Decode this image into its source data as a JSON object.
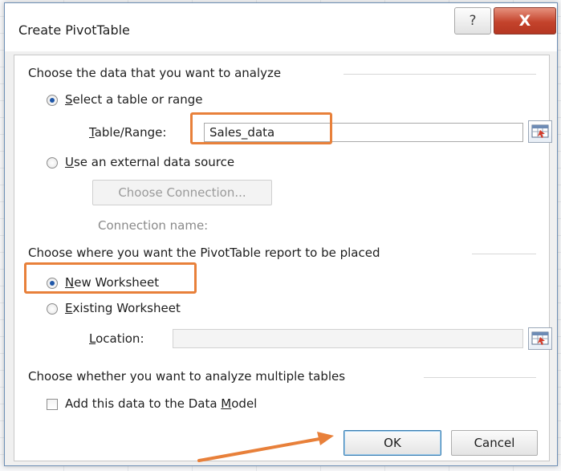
{
  "dialog": {
    "title": "Create PivotTable",
    "help_glyph": "?",
    "close_glyph": "X"
  },
  "section_data": {
    "heading": "Choose the data that you want to analyze",
    "option_table_range": {
      "accel": "S",
      "rest": "elect a table or range",
      "checked": true
    },
    "table_range_label": {
      "accel": "T",
      "rest": "able/Range:"
    },
    "table_range_value": "Sales_data",
    "option_external": {
      "accel": "U",
      "rest": "se an external data source",
      "checked": false
    },
    "choose_connection_label": "Choose Connection...",
    "connection_name_label": "Connection name:"
  },
  "section_location": {
    "heading": "Choose where you want the PivotTable report to be placed",
    "option_new_worksheet": {
      "accel": "N",
      "rest": "ew Worksheet",
      "checked": true
    },
    "option_existing_worksheet": {
      "accel": "E",
      "rest": "xisting Worksheet",
      "checked": false
    },
    "location_label": {
      "accel": "L",
      "rest": "ocation:"
    },
    "location_value": ""
  },
  "section_multiple": {
    "heading": "Choose whether you want to analyze multiple tables",
    "data_model_label_pre": "Add this data to the Data ",
    "data_model_label_accel": "M",
    "data_model_label_post": "odel",
    "data_model_checked": false
  },
  "buttons": {
    "ok": "OK",
    "cancel": "Cancel"
  },
  "colors": {
    "highlight": "#e8803a",
    "radio_dot": "#1f57a8",
    "close_button": "#c4432c"
  },
  "icons": [
    "help-icon",
    "close-icon",
    "range-picker-icon",
    "arrow-annotation"
  ]
}
